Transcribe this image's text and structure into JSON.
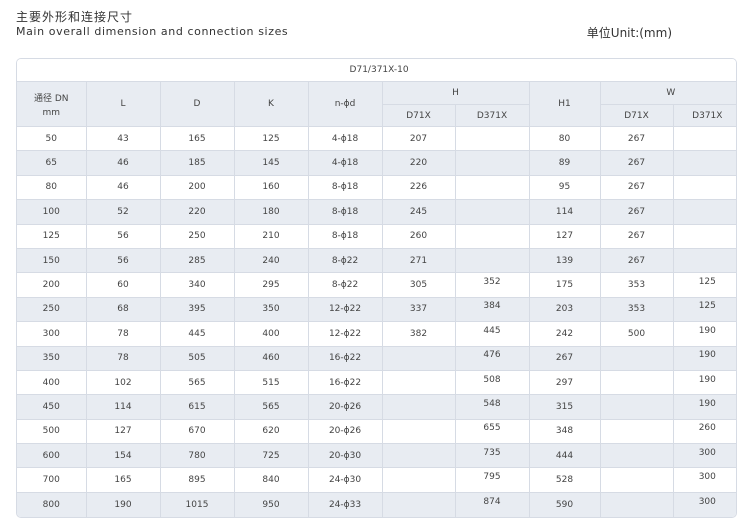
{
  "heading": {
    "title_cn": "主要外形和连接尺寸",
    "title_en": "Main overall dimension and connection sizes",
    "unit": "单位Unit:(mm)"
  },
  "table": {
    "model": "D71/371X-10",
    "headers": {
      "dn": "通径 DN",
      "dn_unit": "mm",
      "L": "L",
      "D": "D",
      "K": "K",
      "nd": "n-ϕd",
      "H": "H",
      "H1": "H1",
      "W": "W",
      "sub_d71x": "D71X",
      "sub_d371x": "D371X"
    },
    "rows": [
      {
        "dn": "50",
        "L": "43",
        "D": "165",
        "K": "125",
        "nd": "4-ϕ18",
        "h_d71x": "207",
        "h_d371x": "",
        "h1": "80",
        "w_d71x": "267",
        "w_d371x": ""
      },
      {
        "dn": "65",
        "L": "46",
        "D": "185",
        "K": "145",
        "nd": "4-ϕ18",
        "h_d71x": "220",
        "h_d371x": "",
        "h1": "89",
        "w_d71x": "267",
        "w_d371x": ""
      },
      {
        "dn": "80",
        "L": "46",
        "D": "200",
        "K": "160",
        "nd": "8-ϕ18",
        "h_d71x": "226",
        "h_d371x": "",
        "h1": "95",
        "w_d71x": "267",
        "w_d371x": ""
      },
      {
        "dn": "100",
        "L": "52",
        "D": "220",
        "K": "180",
        "nd": "8-ϕ18",
        "h_d71x": "245",
        "h_d371x": "",
        "h1": "114",
        "w_d71x": "267",
        "w_d371x": ""
      },
      {
        "dn": "125",
        "L": "56",
        "D": "250",
        "K": "210",
        "nd": "8-ϕ18",
        "h_d71x": "260",
        "h_d371x": "",
        "h1": "127",
        "w_d71x": "267",
        "w_d371x": ""
      },
      {
        "dn": "150",
        "L": "56",
        "D": "285",
        "K": "240",
        "nd": "8-ϕ22",
        "h_d71x": "271",
        "h_d371x": "",
        "h1": "139",
        "w_d71x": "267",
        "w_d371x": ""
      },
      {
        "dn": "200",
        "L": "60",
        "D": "340",
        "K": "295",
        "nd": "8-ϕ22",
        "h_d71x": "305",
        "h_d371x": "352",
        "h1": "175",
        "w_d71x": "353",
        "w_d371x": "125"
      },
      {
        "dn": "250",
        "L": "68",
        "D": "395",
        "K": "350",
        "nd": "12-ϕ22",
        "h_d71x": "337",
        "h_d371x": "384",
        "h1": "203",
        "w_d71x": "353",
        "w_d371x": "125"
      },
      {
        "dn": "300",
        "L": "78",
        "D": "445",
        "K": "400",
        "nd": "12-ϕ22",
        "h_d71x": "382",
        "h_d371x": "445",
        "h1": "242",
        "w_d71x": "500",
        "w_d371x": "190"
      },
      {
        "dn": "350",
        "L": "78",
        "D": "505",
        "K": "460",
        "nd": "16-ϕ22",
        "h_d71x": "",
        "h_d371x": "476",
        "h1": "267",
        "w_d71x": "",
        "w_d371x": "190"
      },
      {
        "dn": "400",
        "L": "102",
        "D": "565",
        "K": "515",
        "nd": "16-ϕ22",
        "h_d71x": "",
        "h_d371x": "508",
        "h1": "297",
        "w_d71x": "",
        "w_d371x": "190"
      },
      {
        "dn": "450",
        "L": "114",
        "D": "615",
        "K": "565",
        "nd": "20-ϕ26",
        "h_d71x": "",
        "h_d371x": "548",
        "h1": "315",
        "w_d71x": "",
        "w_d371x": "190"
      },
      {
        "dn": "500",
        "L": "127",
        "D": "670",
        "K": "620",
        "nd": "20-ϕ26",
        "h_d71x": "",
        "h_d371x": "655",
        "h1": "348",
        "w_d71x": "",
        "w_d371x": "260"
      },
      {
        "dn": "600",
        "L": "154",
        "D": "780",
        "K": "725",
        "nd": "20-ϕ30",
        "h_d71x": "",
        "h_d371x": "735",
        "h1": "444",
        "w_d71x": "",
        "w_d371x": "300"
      },
      {
        "dn": "700",
        "L": "165",
        "D": "895",
        "K": "840",
        "nd": "24-ϕ30",
        "h_d71x": "",
        "h_d371x": "795",
        "h1": "528",
        "w_d71x": "",
        "w_d371x": "300"
      },
      {
        "dn": "800",
        "L": "190",
        "D": "1015",
        "K": "950",
        "nd": "24-ϕ33",
        "h_d71x": "",
        "h_d371x": "874",
        "h1": "590",
        "w_d71x": "",
        "w_d371x": "300"
      }
    ]
  }
}
